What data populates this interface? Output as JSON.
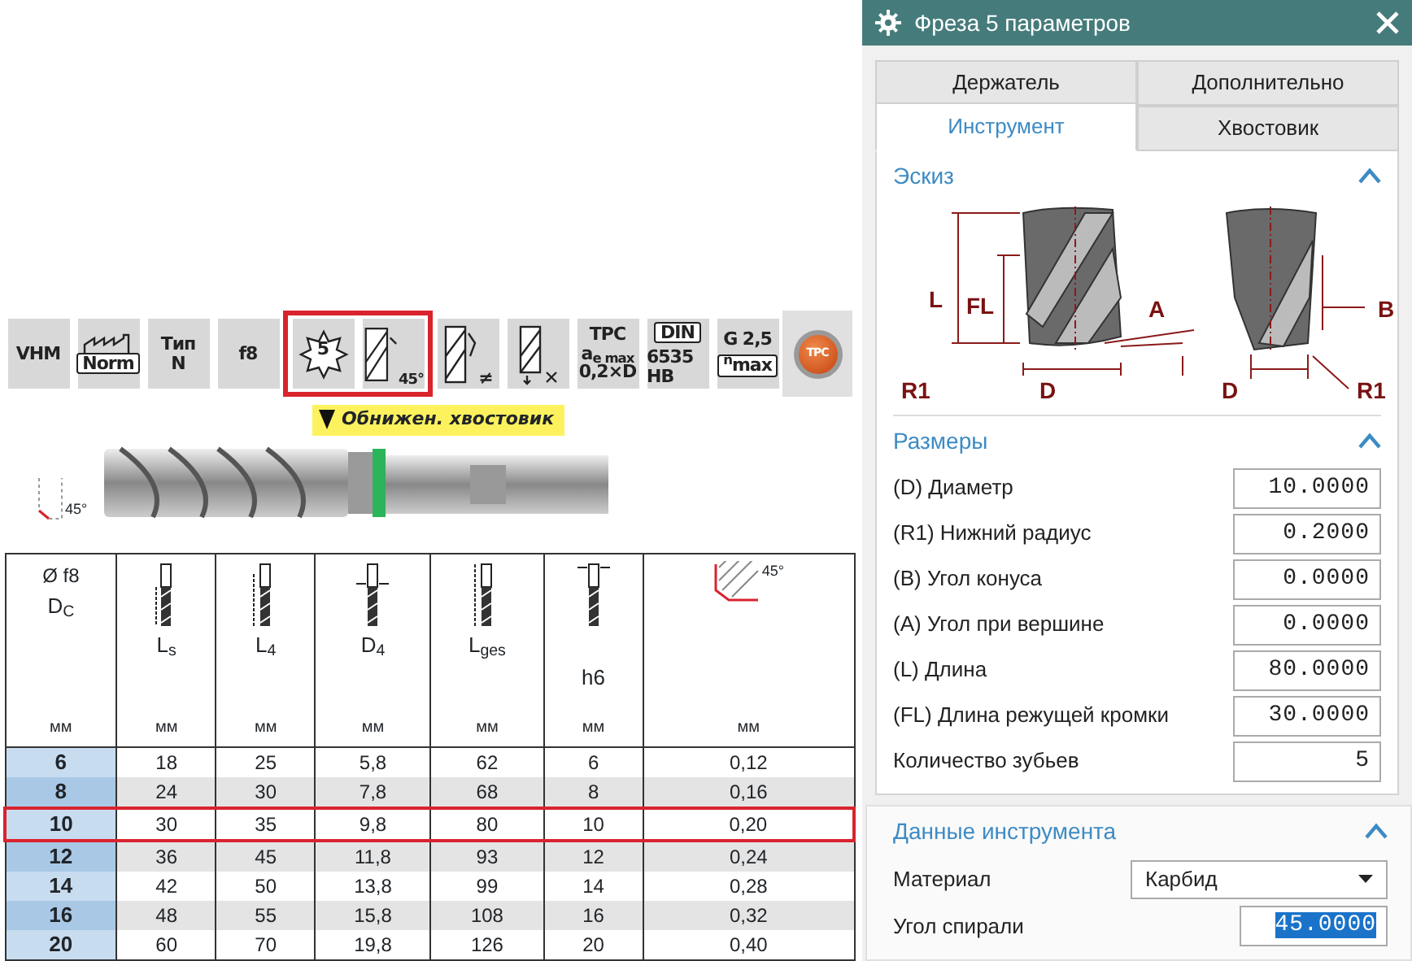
{
  "catalog": {
    "feature_icons": [
      {
        "kind": "text",
        "lines": [
          "VHM"
        ],
        "highlighted": false
      },
      {
        "kind": "norm",
        "lines": [
          "Norm"
        ],
        "highlighted": false
      },
      {
        "kind": "text",
        "lines": [
          "Тип",
          "N"
        ],
        "highlighted": false
      },
      {
        "kind": "text",
        "lines": [
          "f8"
        ],
        "highlighted": false
      },
      {
        "kind": "teeth",
        "lines": [
          "5"
        ],
        "highlighted": true
      },
      {
        "kind": "helix",
        "lines": [
          "45°"
        ],
        "highlighted": true
      },
      {
        "kind": "pitch",
        "lines": [
          "≠"
        ],
        "highlighted": false
      },
      {
        "kind": "direction",
        "highlighted": false
      },
      {
        "kind": "text",
        "lines": [
          "TPC",
          "a$_{e max}$",
          "0,2×D"
        ],
        "highlighted": false
      },
      {
        "kind": "boxed-top",
        "lines": [
          "DIN",
          "6535 HB"
        ],
        "highlighted": false
      },
      {
        "kind": "boxed-bottom",
        "lines": [
          "G 2,5",
          "$^{n}$max"
        ],
        "highlighted": false
      },
      {
        "kind": "badge",
        "lines": [
          "TPC"
        ],
        "highlighted": false
      }
    ],
    "shank_banner": "Обнижен. хвостовик",
    "chamfer_label": "45°",
    "table": {
      "columns": [
        {
          "kind": "none",
          "top": "Ø f8",
          "label": "D$_{C}$",
          "unit": "мм"
        },
        {
          "kind": "shank-length",
          "label": "L$_{s}$",
          "unit": "мм"
        },
        {
          "kind": "neck-length",
          "label": "L$_{4}$",
          "unit": "мм"
        },
        {
          "kind": "neck-diameter",
          "label": "D$_{4}$",
          "unit": "мм"
        },
        {
          "kind": "total-length",
          "label": "L$_{ges}$",
          "unit": "мм"
        },
        {
          "kind": "shank-tolerance",
          "label": "h6",
          "unit": "мм"
        },
        {
          "kind": "chamfer",
          "label": "45°",
          "unit": "мм"
        }
      ],
      "rows": [
        {
          "cells": [
            "6",
            "18",
            "25",
            "5,8",
            "62",
            "6",
            "0,12"
          ],
          "selected": false
        },
        {
          "cells": [
            "8",
            "24",
            "30",
            "7,8",
            "68",
            "8",
            "0,16"
          ],
          "selected": false
        },
        {
          "cells": [
            "10",
            "30",
            "35",
            "9,8",
            "80",
            "10",
            "0,20"
          ],
          "selected": true
        },
        {
          "cells": [
            "12",
            "36",
            "45",
            "11,8",
            "93",
            "12",
            "0,24"
          ],
          "selected": false
        },
        {
          "cells": [
            "14",
            "42",
            "50",
            "13,8",
            "99",
            "14",
            "0,28"
          ],
          "selected": false
        },
        {
          "cells": [
            "16",
            "48",
            "55",
            "15,8",
            "108",
            "16",
            "0,32"
          ],
          "selected": false
        },
        {
          "cells": [
            "20",
            "60",
            "70",
            "19,8",
            "126",
            "20",
            "0,40"
          ],
          "selected": false
        }
      ]
    }
  },
  "dialog": {
    "title": "Фреза 5 параметров",
    "tab_rows": [
      [
        {
          "label": "Держатель",
          "selected": false
        },
        {
          "label": "Дополнительно",
          "selected": false
        }
      ],
      [
        {
          "label": "Инструмент",
          "selected": true
        },
        {
          "label": "Хвостовик",
          "selected": false
        }
      ]
    ],
    "sketch": {
      "title": "Эскиз",
      "expanded": true,
      "labels": [
        "L",
        "FL",
        "A",
        "B",
        "R1",
        "D",
        "D",
        "R1"
      ]
    },
    "dimensions": {
      "title": "Размеры",
      "expanded": true,
      "fields": [
        {
          "label": "(D) Диаметр",
          "value": "10.0000"
        },
        {
          "label": "(R1) Нижний радиус",
          "value": "0.2000"
        },
        {
          "label": "(B) Угол конуса",
          "value": "0.0000"
        },
        {
          "label": "(A) Угол при вершине",
          "value": "0.0000"
        },
        {
          "label": "(L) Длина",
          "value": "80.0000"
        },
        {
          "label": "(FL) Длина режущей кромки",
          "value": "30.0000"
        },
        {
          "label": "Количество зубьев",
          "value": "5"
        }
      ]
    },
    "tool_data": {
      "title": "Данные инструмента",
      "expanded": true,
      "fields": [
        {
          "kind": "select",
          "label": "Материал",
          "value": "Карбид"
        },
        {
          "kind": "number",
          "label": "Угол спирали",
          "value": "45.0000",
          "selected": true
        }
      ]
    }
  }
}
